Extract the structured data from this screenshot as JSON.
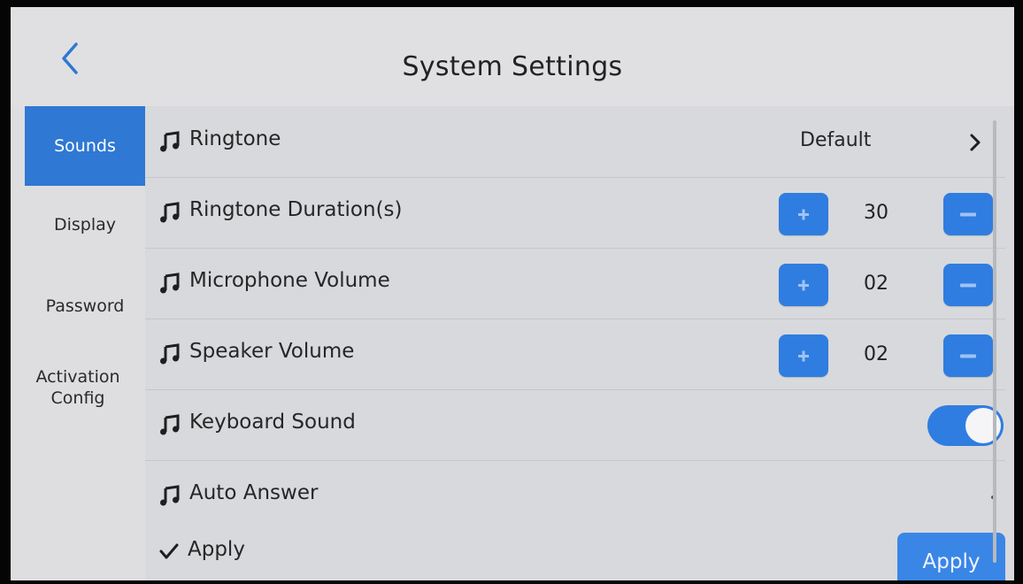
{
  "header": {
    "title": "System Settings",
    "back_icon": "chevron-left-icon"
  },
  "sidebar": {
    "items": [
      {
        "label": "Sounds",
        "active": true
      },
      {
        "label": "Display",
        "active": false
      },
      {
        "label": "Password",
        "active": false
      },
      {
        "label": "Activation Config",
        "active": false
      }
    ]
  },
  "settings": [
    {
      "label": "Ringtone",
      "icon": "music-note-icon",
      "value": "Default",
      "control": "chevron-right"
    },
    {
      "label": "Ringtone Duration(s)",
      "icon": "music-note-icon",
      "value": "30",
      "control": "stepper"
    },
    {
      "label": "Microphone Volume",
      "icon": "music-note-icon",
      "value": "02",
      "control": "stepper"
    },
    {
      "label": "Speaker Volume",
      "icon": "music-note-icon",
      "value": "02",
      "control": "stepper"
    },
    {
      "label": "Keyboard Sound",
      "icon": "music-note-icon",
      "value": "on",
      "control": "toggle"
    },
    {
      "label": "Auto Answer",
      "icon": "music-note-icon",
      "value": "",
      "control": "toggle-hidden"
    }
  ],
  "apply": {
    "label": "Apply",
    "button_label": "Apply",
    "icon": "checkmark-icon"
  },
  "colors": {
    "accent": "#2f7de0",
    "background": "#dcdcdf",
    "text": "#262626"
  }
}
